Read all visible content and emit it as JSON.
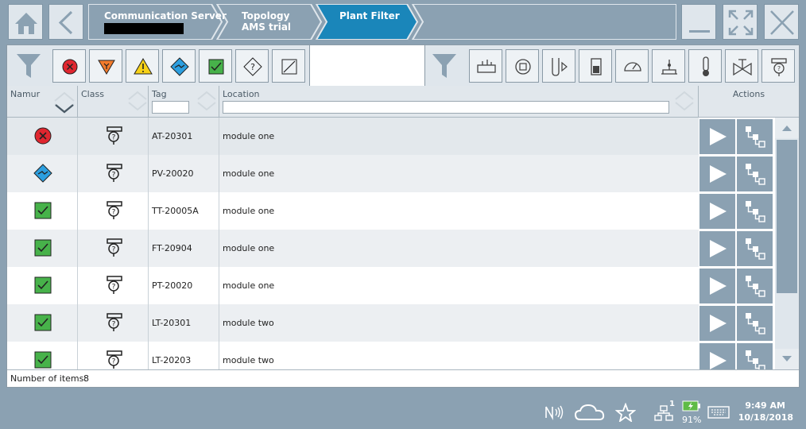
{
  "breadcrumbs": {
    "server_label": "Communication Server",
    "topology_label": "Topology",
    "topology_sub": "AMS trial",
    "active_label": "Plant Filter"
  },
  "toolbar": {
    "home_icon": "home-icon",
    "back_icon": "chevron-left-icon",
    "minimize_icon": "minimize-icon",
    "expand_icon": "expand-icon",
    "close_icon": "close-icon"
  },
  "status_filters": [
    "failure",
    "function-check",
    "out-of-specification",
    "maintenance-required",
    "ok",
    "unknown",
    "not-assigned"
  ],
  "class_filters": [
    "gateway",
    "controller",
    "flow",
    "level-device",
    "pressure",
    "analysis",
    "temperature",
    "valve",
    "unknown-device"
  ],
  "table": {
    "columns": {
      "namur": "Namur",
      "class": "Class",
      "tag": "Tag",
      "location": "Location",
      "actions": "Actions"
    },
    "rows": [
      {
        "status": "failure",
        "tag": "AT-20301",
        "location": "module one"
      },
      {
        "status": "maintenance-required",
        "tag": "PV-20020",
        "location": "module one"
      },
      {
        "status": "ok",
        "tag": "TT-20005A",
        "location": "module one"
      },
      {
        "status": "ok",
        "tag": "FT-20904",
        "location": "module one"
      },
      {
        "status": "ok",
        "tag": "PT-20020",
        "location": "module one"
      },
      {
        "status": "ok",
        "tag": "LT-20301",
        "location": "module two"
      },
      {
        "status": "ok",
        "tag": "LT-20203",
        "location": "module two"
      }
    ],
    "footer_label": "Number of items:",
    "footer_count": "8"
  },
  "taskbar": {
    "network_count": "1",
    "battery": "91%",
    "time": "9:49 AM",
    "date": "10/18/2018"
  },
  "colors": {
    "accent": "#1a86ba",
    "crumb_gray": "#9cb0be",
    "failure": "#e0262f",
    "ok": "#47b24a",
    "warning": "#f7d117",
    "function_check": "#f37b2c",
    "maintenance": "#2c9fe0"
  }
}
